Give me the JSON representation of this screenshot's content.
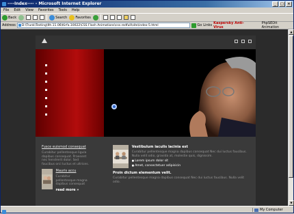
{
  "window": {
    "title": "----Index---- - Microsoft Internet Explorer",
    "buttons": [
      "_",
      "□",
      "×"
    ]
  },
  "menu": [
    "File",
    "Edit",
    "View",
    "Favorites",
    "Tools",
    "Help"
  ],
  "toolbar": {
    "back_label": "Back",
    "search_label": "Search",
    "favorites_label": "Favorites"
  },
  "address": {
    "label": "Address",
    "value": "D:\\Trunk\\Testing\\9h.11.06\\Kirfa.10022\\CSS Flash Animations\\css.redfull\\site\\index-5.html",
    "go_label": "Go",
    "links_label": "Links",
    "links_extra": "Kaspersky Anti-Virus",
    "addon_label": "PhpSEDit Animation"
  },
  "site": {
    "left_col": {
      "link": "Fusce euismod consequat",
      "text": "Curabitur pellentesque ligula dapibus consequat. Praesent nec hendrerit dolor. Sed faucibus orci luctus et ultrices.",
      "item_title": "Mauris accu",
      "item_text": "Curabitur pellentesque magna dapibus consequat",
      "more": "read more »"
    },
    "right_col": {
      "block1_title": "Vestibulum iaculis lacinia est",
      "block1_text": "Curabitur pellentesque magna dapibus consequat Nec dui luctus faucibus. Nulla velit odio, gravida at, molestie quis, dignissim.",
      "bullet1": "Lorem ipsum dolor sit",
      "bullet2": "Amet, consectetuer adipisicin",
      "block2_title": "Proin dictum elementum velit.",
      "block2_text": "Curabitur pellentesque magna dapibus consequat Nec dui luctus faucibus. Nulla velit odio."
    }
  },
  "status": {
    "text": "",
    "zone": "My Computer"
  }
}
